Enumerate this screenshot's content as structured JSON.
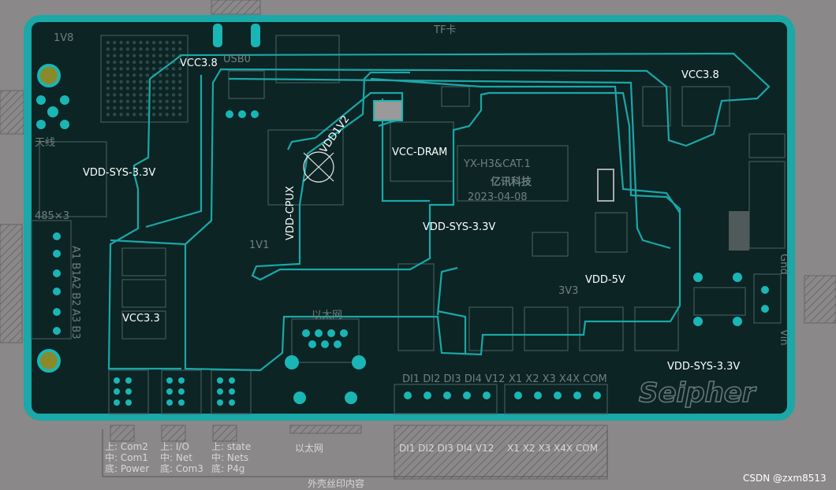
{
  "board": {
    "net_labels": {
      "vcc38_left": "VCC3.8",
      "vcc38_right": "VCC3.8",
      "vdd_sys_left": "VDD-SYS-3.3V",
      "vdd_sys_center": "VDD-SYS-3.3V",
      "vdd_sys_bottom": "VDD-SYS-3.3V",
      "vdd1v2": "VDD1V2",
      "vdd_cpux": "VDD-CPUX",
      "vcc_dram": "VCC-DRAM",
      "vdd_5v": "VDD-5V",
      "vcc33": "VCC3.3"
    },
    "silkscreen": {
      "model": "YX-H3&CAT.1",
      "company": "亿讯科技",
      "date": "2023-04-08",
      "brand": "Seipher",
      "label_1v8": "1V8",
      "label_usb": "USB0",
      "label_tf": "TF卡",
      "label_antenna": "天线",
      "label_rs485": "485×3",
      "label_ethernet": "以太网",
      "label_di_row": "DI1 DI2 DI3 DI4 V12",
      "label_x_row": "X1 X2 X3 X4X  COM",
      "label_a1b1": "A1 B1",
      "label_a2b2": "A2 B2",
      "label_a3b3": "A3 B3",
      "label_gnd": "Gnd",
      "label_vin": "Vin",
      "label_3v3": "3V3",
      "label_1v1": "1V1"
    },
    "below_board": {
      "group1": [
        "上: Com2",
        "中: Com1",
        "底: Power"
      ],
      "group2": [
        "上: I/O",
        "中: Net",
        "底: Com3"
      ],
      "group3": [
        "上: state",
        "中: Nets",
        "底: P4g"
      ],
      "ethernet": "以太网",
      "di_row": "DI1 DI2 DI3 DI4 V12",
      "x_row": "X1 X2 X3 X4X  COM",
      "footer": "外壳丝印内容"
    },
    "watermark": "CSDN @zxm8513",
    "colors": {
      "background": "#8a8888",
      "board_border": "#1aa8a8",
      "board_fill": "#0c2424",
      "trace": "#1aa7a9"
    }
  }
}
